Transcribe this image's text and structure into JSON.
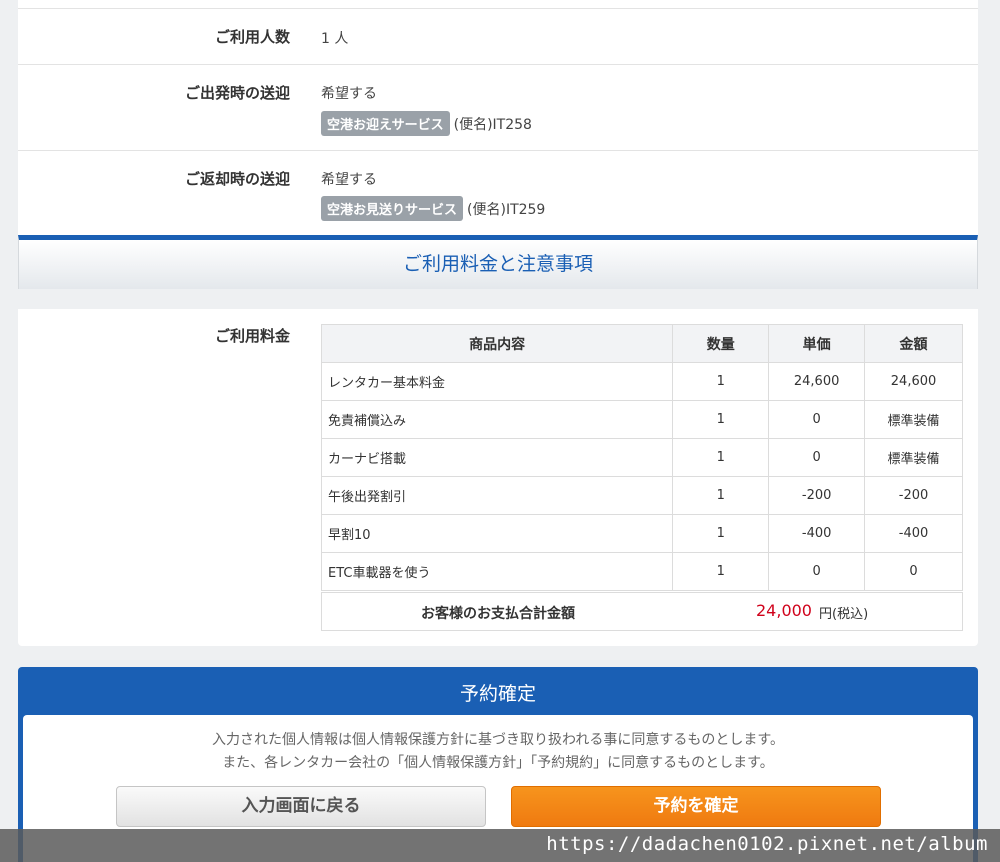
{
  "details": {
    "users": {
      "label": "ご利用人数",
      "value": "1 人"
    },
    "departure": {
      "label": "ご出発時の送迎",
      "value": "希望する",
      "service": "空港お迎えサービス",
      "flight": "(便名)IT258"
    },
    "return": {
      "label": "ご返却時の送迎",
      "value": "希望する",
      "service": "空港お見送りサービス",
      "flight": "(便名)IT259"
    }
  },
  "section": {
    "title": "ご利用料金と注意事項"
  },
  "fee": {
    "label": "ご利用料金",
    "headers": [
      "商品内容",
      "数量",
      "単価",
      "金額"
    ],
    "rows": [
      [
        "レンタカー基本料金",
        "1",
        "24,600",
        "24,600"
      ],
      [
        "免責補償込み",
        "1",
        "0",
        "標準装備"
      ],
      [
        "カーナビ搭載",
        "1",
        "0",
        "標準装備"
      ],
      [
        "午後出発割引",
        "1",
        "-200",
        "-200"
      ],
      [
        "早割10",
        "1",
        "-400",
        "-400"
      ],
      [
        "ETC車載器を使う",
        "1",
        "0",
        "0"
      ]
    ],
    "total_label": "お客様のお支払合計金額",
    "total_amount": "24,000",
    "total_unit": "円(税込)"
  },
  "confirm": {
    "title": "予約確定",
    "notice_line1": "入力された個人情報は個人情報保護方針に基づき取り扱われる事に同意するものとします。",
    "notice_line2": "また、各レンタカー会社の「個人情報保護方針」「予約規約」に同意するものとします。",
    "back_label": "入力画面に戻る",
    "confirm_label": "予約を確定"
  },
  "watermark": "https://dadachen0102.pixnet.net/album",
  "colors": {
    "accent": "#1a5fb4",
    "total": "#d0021b",
    "confirm_button": "#f7941d"
  }
}
